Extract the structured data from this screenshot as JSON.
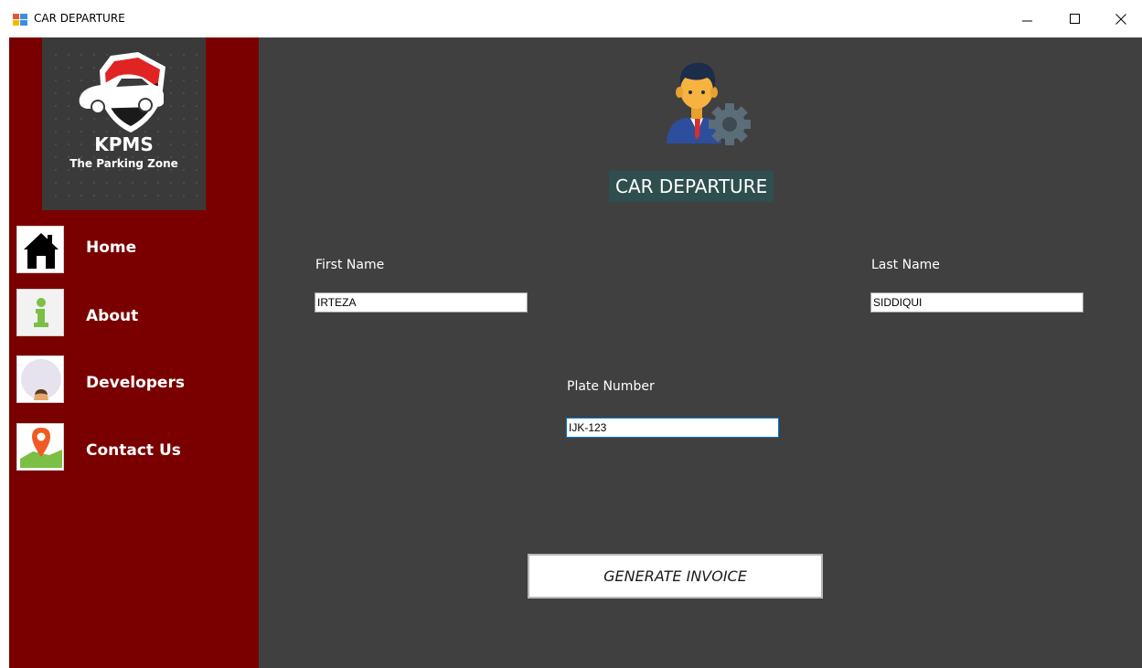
{
  "window": {
    "title": "CAR DEPARTURE",
    "controls": {
      "minimize": "minimize-icon",
      "maximize": "maximize-icon",
      "close": "close-icon"
    }
  },
  "sidebar": {
    "logo": {
      "title": "KPMS",
      "subtitle": "The Parking Zone"
    },
    "items": [
      {
        "label": "Home",
        "icon": "home-icon"
      },
      {
        "label": "About",
        "icon": "about-icon"
      },
      {
        "label": "Developers",
        "icon": "developers-icon"
      },
      {
        "label": "Contact Us",
        "icon": "location-pin-icon"
      }
    ],
    "colors": {
      "background": "#7a0000",
      "logo_panel": "#3a3a3a"
    }
  },
  "main": {
    "header_title": "CAR DEPARTURE",
    "header_icon": "manager-settings-icon",
    "fields": {
      "first_name": {
        "label": "First Name",
        "value": "IRTEZA"
      },
      "last_name": {
        "label": "Last Name",
        "value": "SIDDIQUI"
      },
      "plate_number": {
        "label": "Plate Number",
        "value": "IJK-123"
      }
    },
    "generate_button": "GENERATE INVOICE",
    "colors": {
      "background": "#404040",
      "title_bg": "#2f4f4f"
    }
  }
}
